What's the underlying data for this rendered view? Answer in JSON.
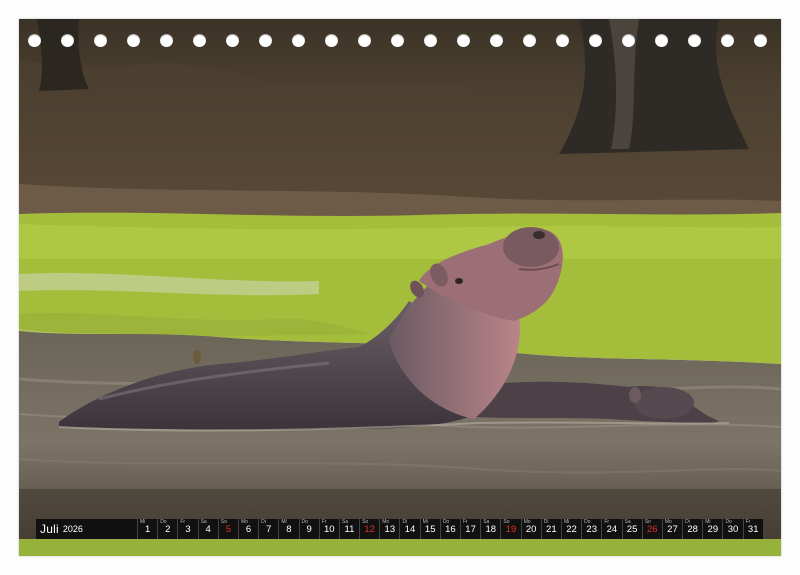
{
  "calendar": {
    "month": "Juli",
    "year": "2026",
    "days": [
      {
        "n": "1",
        "d": "Mi"
      },
      {
        "n": "2",
        "d": "Do"
      },
      {
        "n": "3",
        "d": "Fr"
      },
      {
        "n": "4",
        "d": "Sa"
      },
      {
        "n": "5",
        "d": "So",
        "red": true
      },
      {
        "n": "6",
        "d": "Mo"
      },
      {
        "n": "7",
        "d": "Di"
      },
      {
        "n": "8",
        "d": "Mi"
      },
      {
        "n": "9",
        "d": "Do"
      },
      {
        "n": "10",
        "d": "Fr"
      },
      {
        "n": "11",
        "d": "Sa"
      },
      {
        "n": "12",
        "d": "So",
        "red": true
      },
      {
        "n": "13",
        "d": "Mo"
      },
      {
        "n": "14",
        "d": "Di"
      },
      {
        "n": "15",
        "d": "Mi"
      },
      {
        "n": "16",
        "d": "Do"
      },
      {
        "n": "17",
        "d": "Fr"
      },
      {
        "n": "18",
        "d": "Sa"
      },
      {
        "n": "19",
        "d": "So",
        "red": true
      },
      {
        "n": "20",
        "d": "Mo"
      },
      {
        "n": "21",
        "d": "Di"
      },
      {
        "n": "22",
        "d": "Mi"
      },
      {
        "n": "23",
        "d": "Do"
      },
      {
        "n": "24",
        "d": "Fr"
      },
      {
        "n": "25",
        "d": "Sa"
      },
      {
        "n": "26",
        "d": "So",
        "red": true
      },
      {
        "n": "27",
        "d": "Mo"
      },
      {
        "n": "28",
        "d": "Di"
      },
      {
        "n": "29",
        "d": "Mi"
      },
      {
        "n": "30",
        "d": "Do"
      },
      {
        "n": "31",
        "d": "Fr"
      }
    ]
  },
  "binding_holes": 23,
  "colors": {
    "calendar_bar": "#111111",
    "sunday_red": "#e0312b",
    "water_lettuce": "#a9c43a",
    "hippo_skin": "#5a4f59",
    "hippo_pink": "#b47a7f"
  }
}
